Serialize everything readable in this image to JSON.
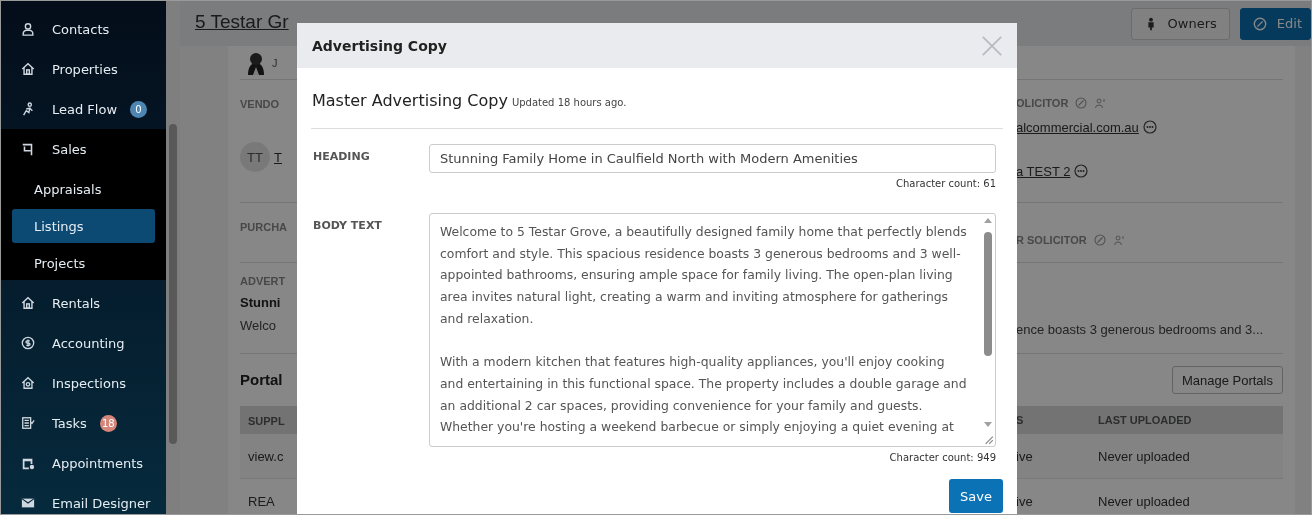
{
  "sidebar": {
    "items": [
      {
        "label": "Contacts",
        "selected": false
      },
      {
        "label": "Properties",
        "selected": false
      },
      {
        "label": "Lead Flow",
        "selected": false,
        "badge": "0",
        "color": "#4d86b3"
      },
      {
        "label": "Sales",
        "selected": false,
        "expanded": true,
        "children": [
          {
            "label": "Appraisals",
            "selected": false
          },
          {
            "label": "Listings",
            "selected": true
          },
          {
            "label": "Projects",
            "selected": false
          }
        ]
      },
      {
        "label": "Rentals",
        "selected": false
      },
      {
        "label": "Accounting",
        "selected": false
      },
      {
        "label": "Inspections",
        "selected": false
      },
      {
        "label": "Tasks",
        "selected": false,
        "badge": "18",
        "color": "#d5867a"
      },
      {
        "label": "Appointments",
        "selected": false
      },
      {
        "label": "Email Designer",
        "selected": false
      }
    ]
  },
  "page_header": {
    "title": "5 Testar Gr",
    "buttons": [
      {
        "label": "Owners",
        "kind": "secondary"
      },
      {
        "label": "Edit",
        "kind": "primary"
      }
    ]
  },
  "listing": {
    "agent_initial": "J",
    "vendor": {
      "label": "VENDO",
      "avatar": "TT",
      "link": "T"
    },
    "vendor_solicitor": {
      "label": "OLICITOR",
      "links": [
        "alcommercial.com.au",
        "a TEST 2"
      ]
    },
    "purchaser": {
      "label": "PURCHA"
    },
    "purchaser_solicitor": {
      "label": "R SOLICITOR"
    },
    "advertising": {
      "label": "ADVERT",
      "heading": "Stunni",
      "body_start": "Welco",
      "body_end": "ence boasts 3 generous bedrooms and 3..."
    },
    "portals": {
      "title": "Portal",
      "button": "Manage Portals",
      "columns": [
        "SUPPL",
        "S",
        "LAST UPLOADED"
      ],
      "rows": [
        [
          "view.c",
          "ive",
          "Never uploaded"
        ],
        [
          "REA",
          "ive",
          "Never uploaded"
        ]
      ]
    }
  },
  "modal": {
    "title": "Advertising Copy",
    "section_title": "Master Advertising Copy",
    "updated": "Updated 18 hours ago.",
    "fields": [
      {
        "label": "HEADING",
        "kind": "input",
        "value": "Stunning Family Home in Caulfield North with Modern Amenities",
        "count": "Character count: 61"
      },
      {
        "label": "BODY TEXT",
        "kind": "textarea",
        "value": "Welcome to 5 Testar Grove, a beautifully designed family home that perfectly blends comfort and style. This spacious residence boasts 3 generous bedrooms and 3 well-appointed bathrooms, ensuring ample space for family living. The open-plan living area invites natural light, creating a warm and inviting atmosphere for gatherings and relaxation.\n\nWith a modern kitchen that features high-quality appliances, you'll enjoy cooking and entertaining in this functional space. The property includes a double garage and an additional 2 car spaces, providing convenience for your family and guests. Whether you're hosting a weekend barbecue or simply enjoying a quiet evening at",
        "count": "Character count: 949"
      }
    ],
    "save": "Save"
  }
}
